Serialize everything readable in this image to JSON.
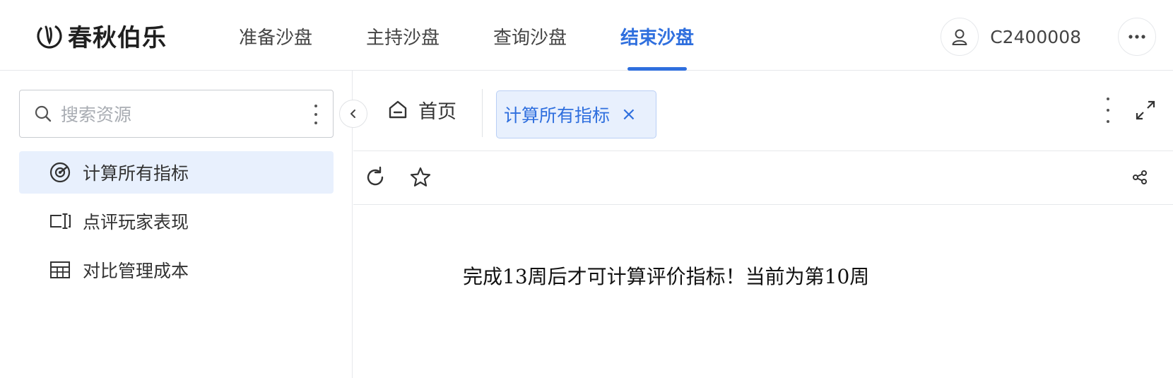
{
  "header": {
    "logo_text": "春秋伯乐",
    "nav": [
      {
        "label": "准备沙盘",
        "active": false
      },
      {
        "label": "主持沙盘",
        "active": false
      },
      {
        "label": "查询沙盘",
        "active": false
      },
      {
        "label": "结束沙盘",
        "active": true
      }
    ],
    "user_name": "C2400008"
  },
  "sidebar": {
    "search_placeholder": "搜索资源",
    "items": [
      {
        "label": "计算所有指标",
        "icon": "gauge-icon",
        "active": true
      },
      {
        "label": "点评玩家表现",
        "icon": "comment-cursor-icon",
        "active": false
      },
      {
        "label": "对比管理成本",
        "icon": "table-icon",
        "active": false
      }
    ]
  },
  "tabs": {
    "home_label": "首页",
    "active_label": "计算所有指标",
    "close_symbol": "×"
  },
  "content": {
    "message": "完成13周后才可计算评价指标！当前为第10周"
  },
  "colors": {
    "accent": "#2f6fde",
    "active_bg": "#e8f0fd",
    "border": "#e6e8eb"
  }
}
